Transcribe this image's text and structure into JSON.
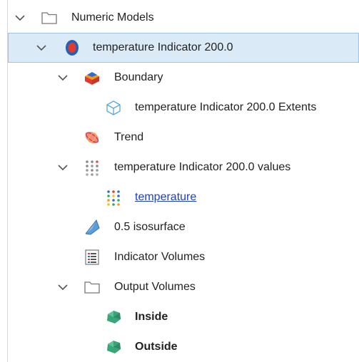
{
  "tree": {
    "root": {
      "label": "Numeric Models",
      "expanded": true,
      "icon": "folder-icon"
    },
    "model": {
      "label": "temperature Indicator 200.0",
      "expanded": true,
      "selected": true,
      "icon": "indicator-model-icon"
    },
    "boundary": {
      "label": "Boundary",
      "expanded": true,
      "icon": "boundary-icon"
    },
    "extents": {
      "label": "temperature Indicator 200.0 Extents",
      "icon": "extents-cube-icon"
    },
    "trend": {
      "label": "Trend",
      "icon": "trend-ellipsoid-icon"
    },
    "values": {
      "label": "temperature Indicator 200.0 values",
      "expanded": true,
      "icon": "points-grey-icon"
    },
    "temperature": {
      "label": "temperature",
      "link": true,
      "icon": "points-colored-icon"
    },
    "isosurface": {
      "label": "0.5 isosurface",
      "icon": "isosurface-icon"
    },
    "volumes": {
      "label": "Indicator Volumes",
      "icon": "table-icon"
    },
    "output": {
      "label": "Output Volumes",
      "expanded": true,
      "icon": "folder-icon"
    },
    "inside": {
      "label": "Inside",
      "bold": true,
      "icon": "volume-green-icon"
    },
    "outside": {
      "label": "Outside",
      "bold": true,
      "icon": "volume-green-icon"
    }
  },
  "colors": {
    "selection_bg": "#dbeaf7",
    "selection_border": "#9cc3e6",
    "link": "#1a3fd6",
    "volume_green": "#3aa57a"
  }
}
